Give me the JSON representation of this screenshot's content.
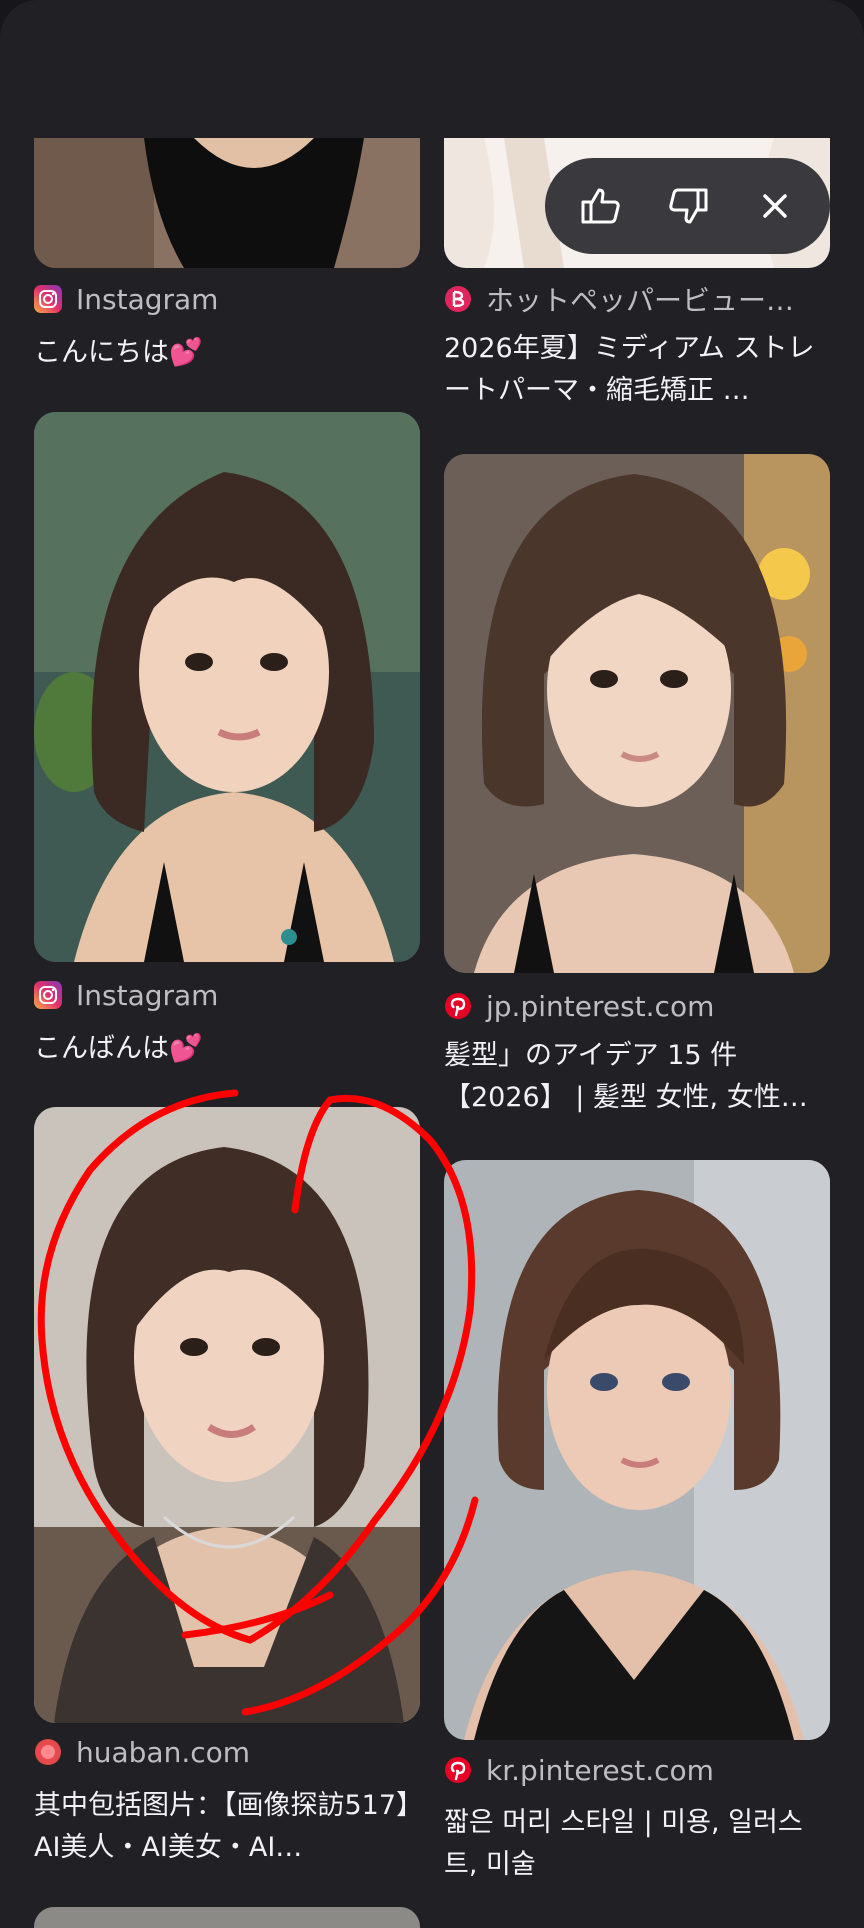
{
  "feedback": {
    "like_icon": "thumb-up-icon",
    "dislike_icon": "thumb-down-icon",
    "close_icon": "close-icon"
  },
  "results": [
    {
      "id": "r1",
      "source": "Instagram",
      "source_icon": "instagram-icon",
      "title": "こんにちは💕"
    },
    {
      "id": "r2",
      "source": "ホットペッパービュー…",
      "source_icon": "hotpepper-beauty-icon",
      "title": "2026年夏】ミディアム ストレートパーマ・縮毛矯正 …"
    },
    {
      "id": "r3",
      "source": "Instagram",
      "source_icon": "instagram-icon",
      "title": "こんばんは💕"
    },
    {
      "id": "r4",
      "source": "jp.pinterest.com",
      "source_icon": "pinterest-icon",
      "title": "髪型」のアイデア 15 件【2026】 | 髪型 女性, 女性…"
    },
    {
      "id": "r5",
      "source": "huaban.com",
      "source_icon": "huaban-icon",
      "title": "其中包括图片：【画像探訪517】AI美人・AI美女・AI…",
      "annotated": true
    },
    {
      "id": "r6",
      "source": "kr.pinterest.com",
      "source_icon": "pinterest-icon",
      "title": "짧은 머리 스타일 | 미용, 일러스트, 미술"
    }
  ],
  "colors": {
    "background": "#212125",
    "annotation": "#ff0000",
    "pinterest": "#e60023"
  }
}
